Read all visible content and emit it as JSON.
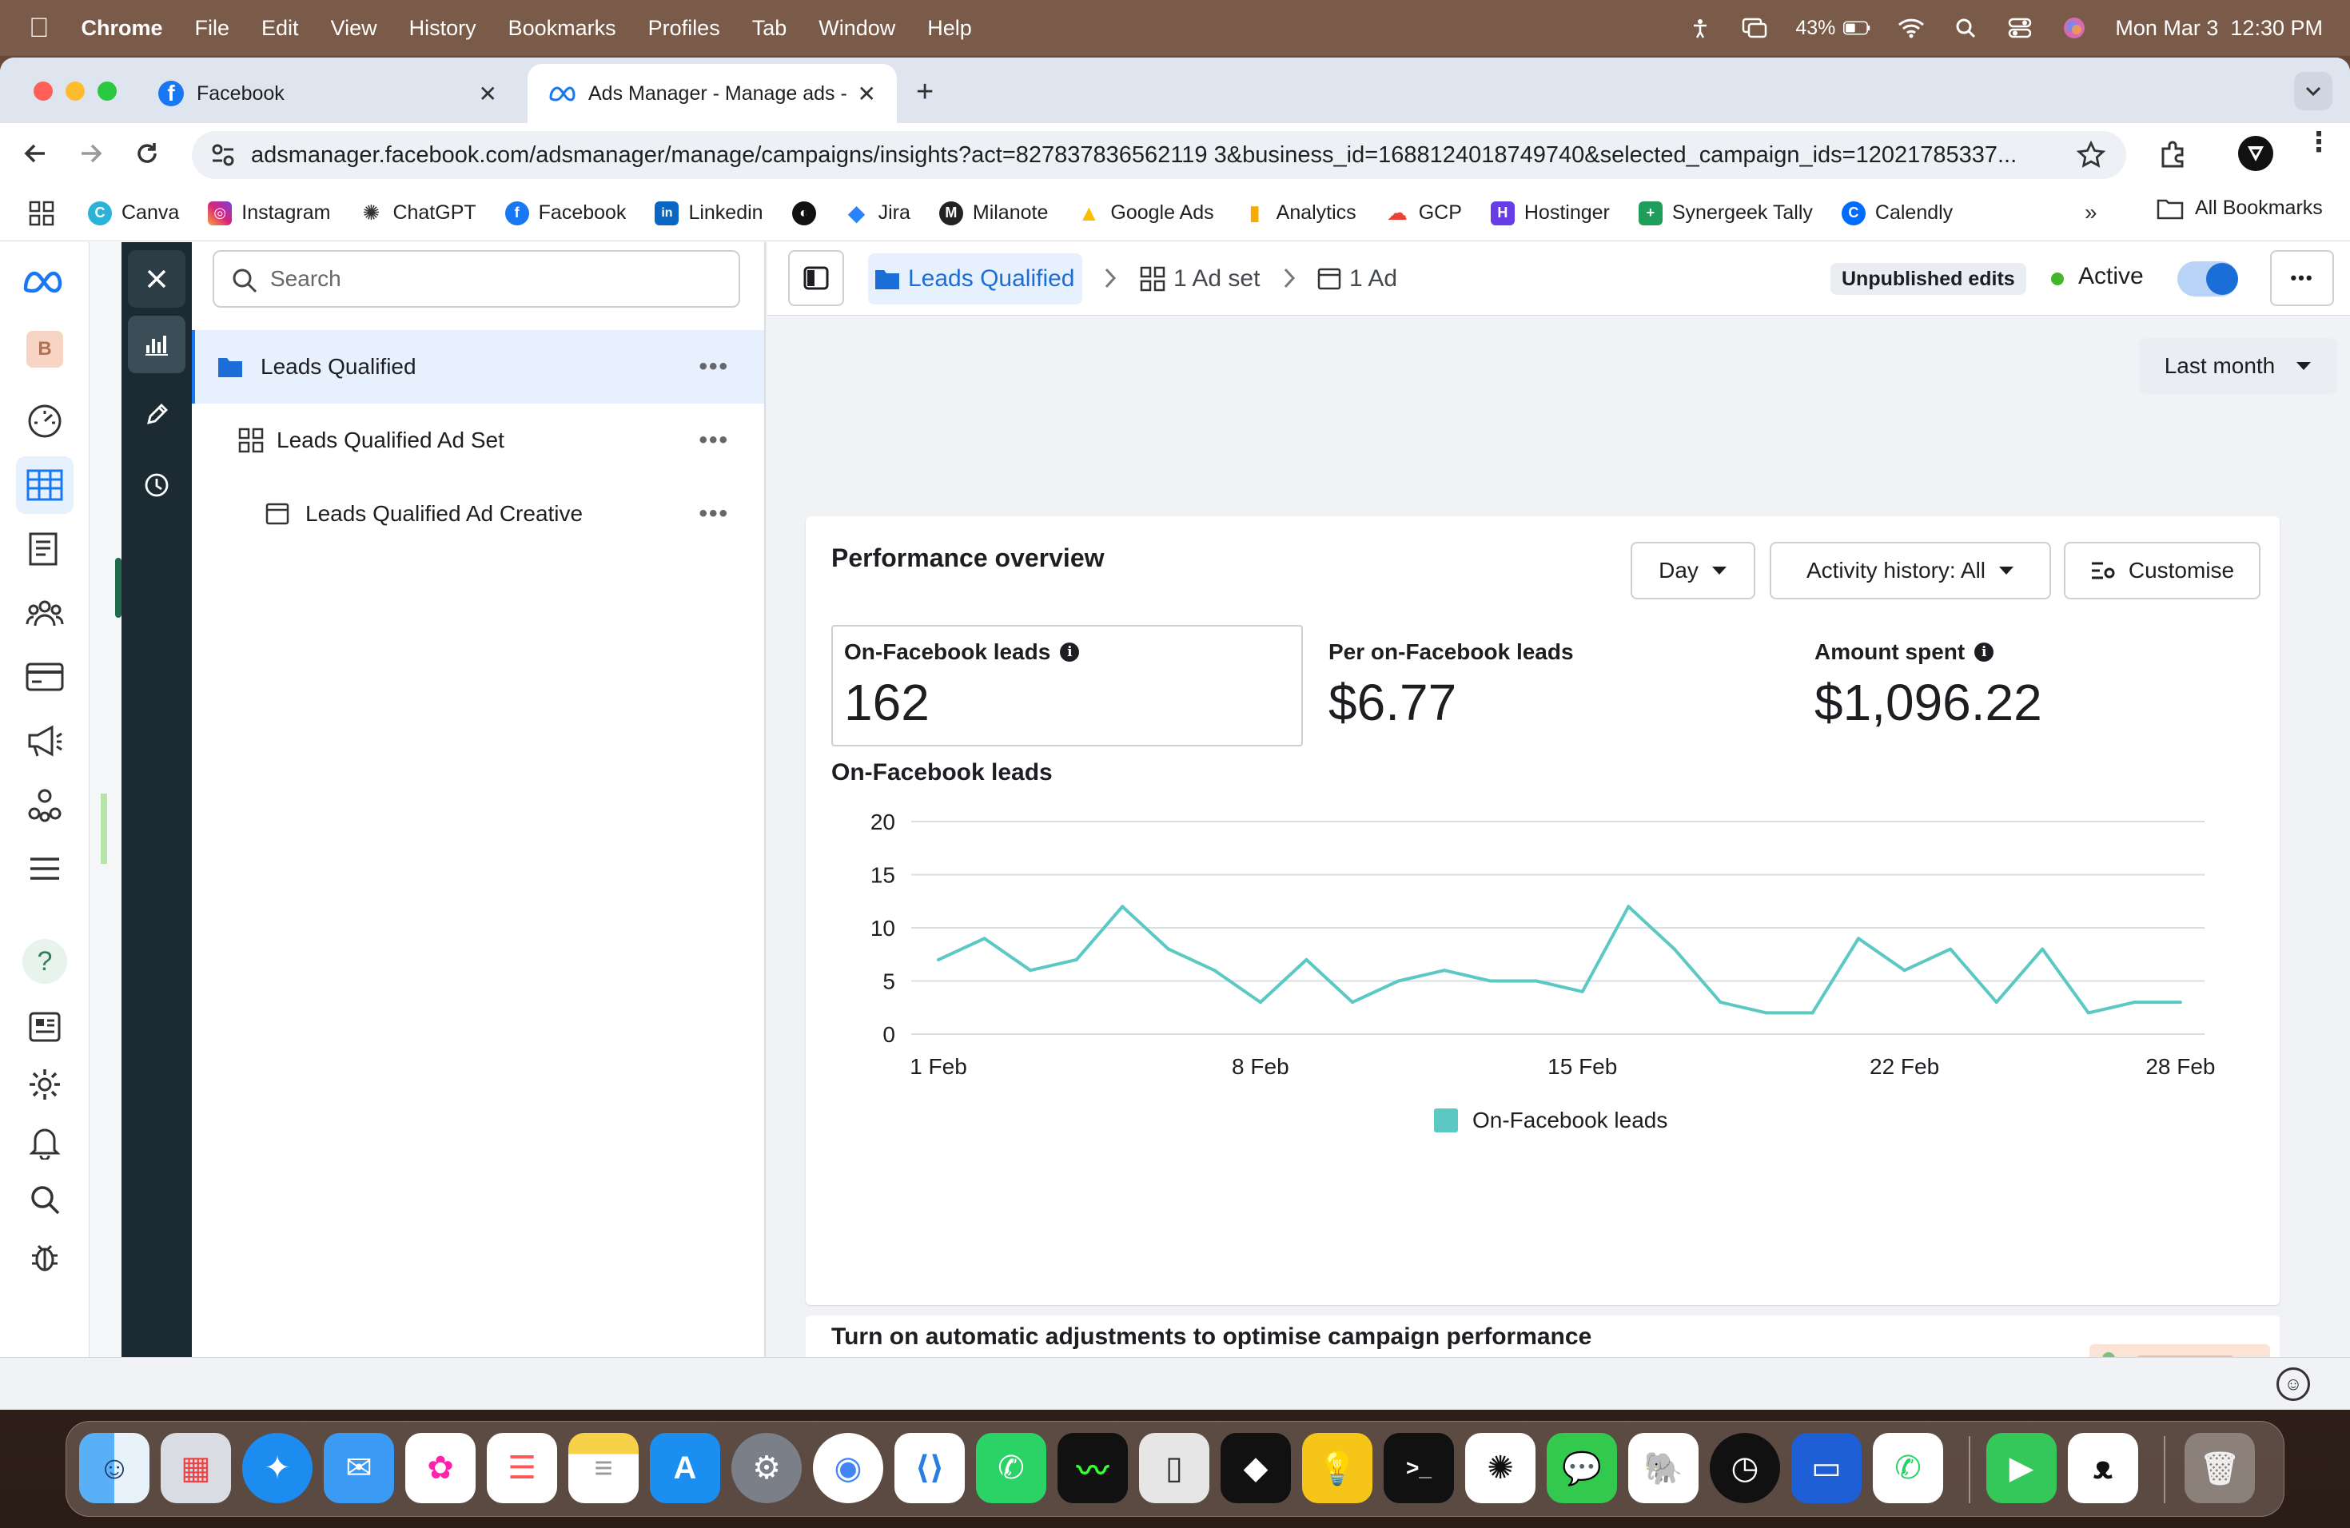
{
  "menubar": {
    "app": "Chrome",
    "items": [
      "File",
      "Edit",
      "View",
      "History",
      "Bookmarks",
      "Profiles",
      "Tab",
      "Window",
      "Help"
    ],
    "battery": "43%",
    "datetime": "Mon Mar 3  12:30 PM"
  },
  "browser": {
    "tabs": [
      {
        "title": "Facebook"
      },
      {
        "title": "Ads Manager - Manage ads -"
      }
    ],
    "url": "adsmanager.facebook.com/adsmanager/manage/campaigns/insights?act=827837836562119 3&business_id=1688124018749740&selected_campaign_ids=12021785337...",
    "bookmarks": [
      "Canva",
      "Instagram",
      "ChatGPT",
      "Facebook",
      "Linkedin",
      "Jira",
      "Milanote",
      "Google Ads",
      "Analytics",
      "GCP",
      "Hostinger",
      "Synergeek Tally",
      "Calendly"
    ],
    "all_bookmarks": "All Bookmarks"
  },
  "leftnav": {
    "account_initial": "B"
  },
  "tree": {
    "search_placeholder": "Search",
    "items": [
      {
        "label": "Leads Qualified"
      },
      {
        "label": "Leads Qualified Ad Set"
      },
      {
        "label": "Leads Qualified Ad Creative"
      }
    ]
  },
  "topbar": {
    "breadcrumb_campaign": "Leads Qualified",
    "breadcrumb_adset": "1 Ad set",
    "breadcrumb_ad": "1 Ad",
    "unpublished": "Unpublished edits",
    "status": "Active",
    "date_range": "Last month"
  },
  "performance": {
    "title": "Performance overview",
    "granularity": "Day",
    "activity": "Activity history: All",
    "customise": "Customise",
    "metrics": [
      {
        "label": "On-Facebook leads",
        "value": "162"
      },
      {
        "label": "Per on-Facebook leads",
        "value": "$6.77"
      },
      {
        "label": "Amount spent",
        "value": "$1,096.22"
      }
    ],
    "chart_title": "On-Facebook leads"
  },
  "chart_data": {
    "type": "line",
    "title": "On-Facebook leads",
    "x": [
      "1 Feb",
      "2 Feb",
      "3 Feb",
      "4 Feb",
      "5 Feb",
      "6 Feb",
      "7 Feb",
      "8 Feb",
      "9 Feb",
      "10 Feb",
      "11 Feb",
      "12 Feb",
      "13 Feb",
      "14 Feb",
      "15 Feb",
      "16 Feb",
      "17 Feb",
      "18 Feb",
      "19 Feb",
      "20 Feb",
      "21 Feb",
      "22 Feb",
      "23 Feb",
      "24 Feb",
      "25 Feb",
      "26 Feb",
      "27 Feb",
      "28 Feb"
    ],
    "x_tick_labels": [
      "1 Feb",
      "8 Feb",
      "15 Feb",
      "22 Feb",
      "28 Feb"
    ],
    "y_ticks": [
      "0",
      "5",
      "10",
      "15",
      "20"
    ],
    "ylim": [
      0,
      20
    ],
    "series": [
      {
        "name": "On-Facebook leads",
        "color": "#5bc8c4",
        "values": [
          7,
          9,
          6,
          7,
          12,
          8,
          6,
          3,
          7,
          3,
          5,
          6,
          5,
          5,
          4,
          12,
          8,
          3,
          2,
          2,
          9,
          6,
          8,
          3,
          8,
          2,
          3,
          3
        ]
      }
    ],
    "grid": true,
    "legend": "bottom-center"
  },
  "automation_card": {
    "title": "Turn on automatic adjustments to optimise campaign performance across your account"
  },
  "dock": {
    "apps": [
      "Finder",
      "Launchpad",
      "Safari",
      "Mail",
      "Photos",
      "Reminders",
      "Notes",
      "App Store",
      "System Settings",
      "Chrome",
      "VS Code",
      "WhatsApp",
      "Activity Monitor",
      "Simulator",
      "Cursor",
      "Tips",
      "Terminal",
      "ChatGPT",
      "Messages",
      "pgAdmin",
      "Clock",
      "Screen Sharing",
      "WhatsApp Business",
      "FaceTime",
      "Ollama",
      "Trash"
    ]
  },
  "colors": {
    "accent": "#1877f2",
    "line": "#5bc8c4",
    "rail": "#1c2b33"
  }
}
